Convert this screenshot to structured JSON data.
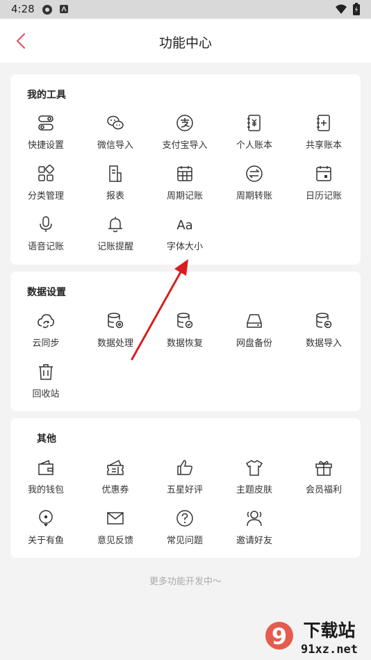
{
  "status_bar": {
    "time": "4:28"
  },
  "header": {
    "title": "功能中心"
  },
  "sections": [
    {
      "title": "我的工具",
      "items": [
        {
          "label": "快捷设置",
          "icon": "toggle-settings-icon"
        },
        {
          "label": "微信导入",
          "icon": "wechat-icon"
        },
        {
          "label": "支付宝导入",
          "icon": "alipay-icon"
        },
        {
          "label": "个人账本",
          "icon": "personal-ledger-icon"
        },
        {
          "label": "共享账本",
          "icon": "shared-ledger-icon"
        },
        {
          "label": "分类管理",
          "icon": "category-icon"
        },
        {
          "label": "报表",
          "icon": "report-icon"
        },
        {
          "label": "周期记账",
          "icon": "calendar-grid-icon"
        },
        {
          "label": "周期转账",
          "icon": "transfer-icon"
        },
        {
          "label": "日历记账",
          "icon": "calendar-icon"
        },
        {
          "label": "语音记账",
          "icon": "microphone-icon"
        },
        {
          "label": "记账提醒",
          "icon": "bell-icon"
        },
        {
          "label": "字体大小",
          "icon": "font-size-icon"
        }
      ]
    },
    {
      "title": "数据设置",
      "items": [
        {
          "label": "云同步",
          "icon": "cloud-sync-icon"
        },
        {
          "label": "数据处理",
          "icon": "database-gear-icon"
        },
        {
          "label": "数据恢复",
          "icon": "database-check-icon"
        },
        {
          "label": "网盘备份",
          "icon": "drive-icon"
        },
        {
          "label": "数据导入",
          "icon": "database-import-icon"
        },
        {
          "label": "回收站",
          "icon": "trash-icon"
        }
      ]
    },
    {
      "title": "其他",
      "items": [
        {
          "label": "我的钱包",
          "icon": "wallet-icon"
        },
        {
          "label": "优惠券",
          "icon": "coupon-icon"
        },
        {
          "label": "五星好评",
          "icon": "thumbs-up-icon"
        },
        {
          "label": "主题皮肤",
          "icon": "tshirt-icon"
        },
        {
          "label": "会员福利",
          "icon": "gift-icon"
        },
        {
          "label": "关于有鱼",
          "icon": "location-pin-icon"
        },
        {
          "label": "意见反馈",
          "icon": "mail-icon"
        },
        {
          "label": "常见问题",
          "icon": "help-icon"
        },
        {
          "label": "邀请好友",
          "icon": "invite-friends-icon"
        }
      ]
    }
  ],
  "footer": {
    "text": "更多功能开发中～"
  },
  "watermark": {
    "brand": "9",
    "text": "下载站",
    "url": "91xz.net"
  },
  "colors": {
    "accent": "#e0566a",
    "arrow": "#d81e1e",
    "background": "#f3f3f3"
  }
}
